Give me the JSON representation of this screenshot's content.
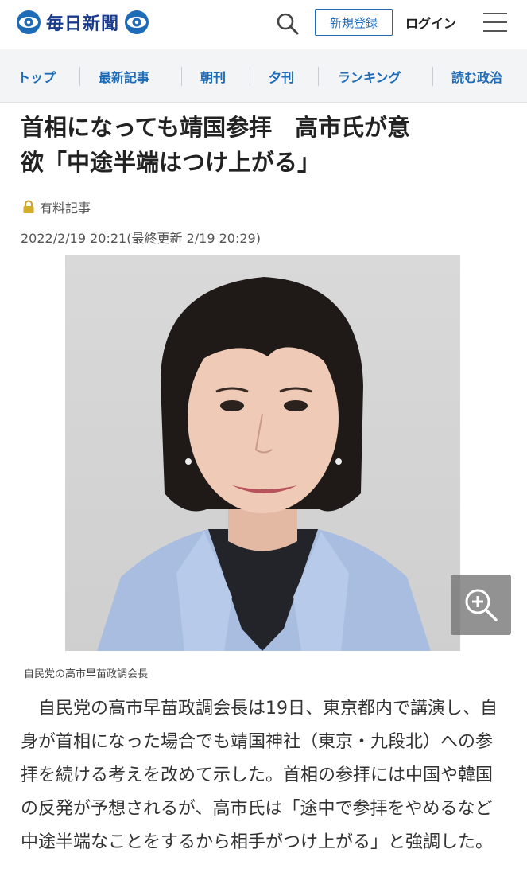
{
  "header": {
    "logo_text": "毎日新聞",
    "signup_label": "新規登録",
    "login_label": "ログイン",
    "icons": [
      "mainichi-logo-icon",
      "search-icon",
      "hamburger-menu-icon"
    ],
    "brand_color": "#1a3b8c",
    "accent_color": "#1e6bb8"
  },
  "nav": {
    "items": [
      {
        "label": "トップ"
      },
      {
        "label": "最新記事"
      },
      {
        "label": "朝刊"
      },
      {
        "label": "夕刊"
      },
      {
        "label": "ランキング"
      },
      {
        "label": "読む政治"
      }
    ]
  },
  "article": {
    "headline_line1": "首相になっても靖国参拝　高市氏が意",
    "headline_line2": "欲「中途半端はつけ上がる」",
    "paid_label": "有料記事",
    "date": "2022/2/19 20:21(最終更新 2/19 20:29)",
    "photo_caption": "自民党の高市早苗政調会長",
    "body": "自民党の高市早苗政調会長は19日、東京都内で講演し、自身が首相になった場合でも靖国神社（東京・九段北）への参拝を続ける考えを改めて示した。首相の参拝には中国や韓国の反発が予想されるが、高市氏は「途中で参拝をやめるなど中途半端なことをするから相手がつけ上がる」と強調した。"
  }
}
